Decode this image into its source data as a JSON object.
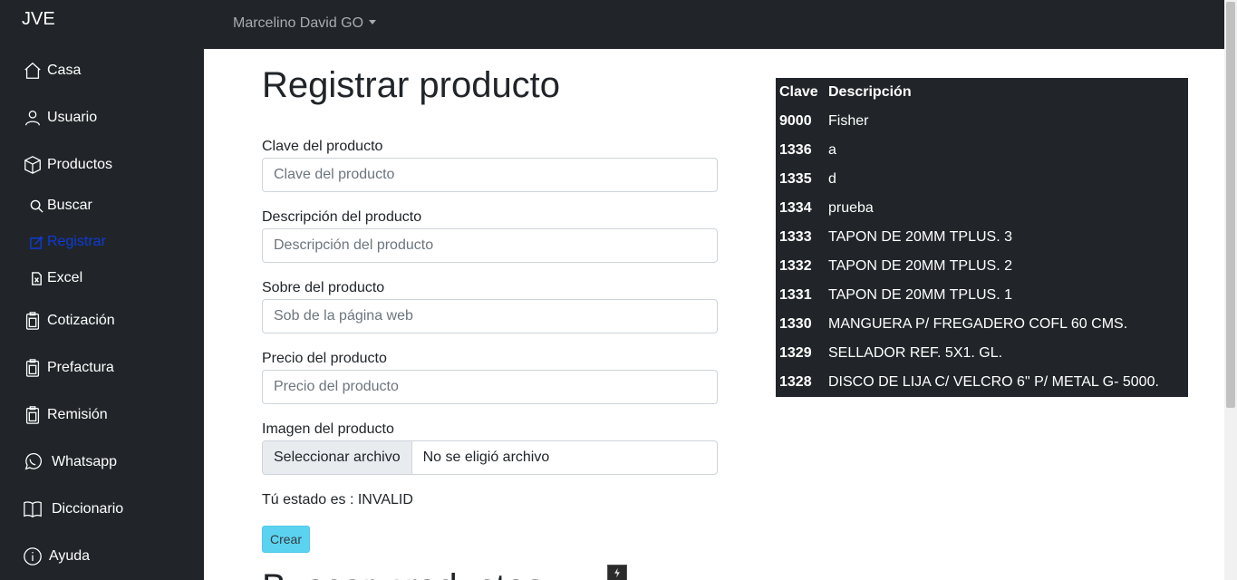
{
  "sidebar": {
    "brand": "JVE",
    "items": [
      {
        "label": "Casa",
        "icon": "house-icon"
      },
      {
        "label": "Usuario",
        "icon": "person-icon"
      },
      {
        "label": "Productos",
        "icon": "box-icon"
      },
      {
        "label": "Cotización",
        "icon": "document-icon"
      },
      {
        "label": "Prefactura",
        "icon": "document-icon"
      },
      {
        "label": "Remisión",
        "icon": "document-icon"
      },
      {
        "label": "Whatsapp",
        "icon": "whatsapp-icon"
      },
      {
        "label": "Diccionario",
        "icon": "book-icon"
      },
      {
        "label": "Ayuda",
        "icon": "info-icon"
      }
    ],
    "subitems": [
      {
        "label": "Buscar",
        "icon": "search-icon"
      },
      {
        "label": "Registrar",
        "icon": "edit-icon"
      },
      {
        "label": "Excel",
        "icon": "excel-file-icon"
      }
    ]
  },
  "topbar": {
    "user": "Marcelino David GO"
  },
  "form": {
    "title": "Registrar producto",
    "fields": [
      {
        "label": "Clave del producto",
        "placeholder": "Clave del producto"
      },
      {
        "label": "Descripción del producto",
        "placeholder": "Descripción del producto"
      },
      {
        "label": "Sobre del producto",
        "placeholder": "Sob de la página web"
      },
      {
        "label": "Precio del producto",
        "placeholder": "Precio del producto"
      }
    ],
    "image_label": "Imagen del producto",
    "file_button": "Seleccionar archivo",
    "file_none": "No se eligió archivo",
    "status": "Tú estado es : INVALID",
    "create_button": "Crear",
    "next_heading": "Buscar productos"
  },
  "table": {
    "headers": [
      "Clave",
      "Descripción"
    ],
    "rows": [
      [
        "9000",
        "Fisher"
      ],
      [
        "1336",
        "a"
      ],
      [
        "1335",
        "d"
      ],
      [
        "1334",
        "prueba"
      ],
      [
        "1333",
        "TAPON DE 20MM TPLUS. 3"
      ],
      [
        "1332",
        "TAPON DE 20MM TPLUS. 2"
      ],
      [
        "1331",
        "TAPON DE 20MM TPLUS. 1"
      ],
      [
        "1330",
        "MANGUERA P/ FREGADERO COFL 60 CMS."
      ],
      [
        "1329",
        "SELLADOR REF. 5X1. GL."
      ],
      [
        "1328",
        "DISCO DE LIJA C/ VELCRO 6\" P/ METAL G- 5000."
      ]
    ]
  },
  "colors": {
    "sidebar_bg": "#212529",
    "active_link": "#0d3bd6",
    "create_button": "#5bd3f0"
  }
}
